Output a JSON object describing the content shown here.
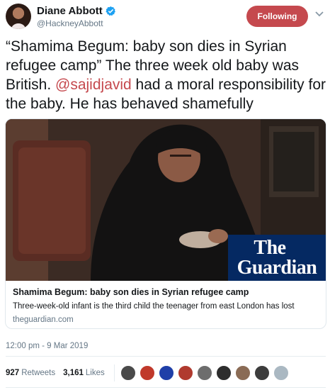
{
  "author": {
    "display_name": "Diane Abbott",
    "handle": "@HackneyAbbott",
    "verified_icon": "verified-badge-icon"
  },
  "follow_button": {
    "label": "Following"
  },
  "tweet": {
    "text_part1": "“Shamima Begum: baby son dies in Syrian refugee camp” The three week old baby was British. ",
    "mention": "@sajidjavid",
    "text_part2": " had a moral responsibility for the baby. He has behaved shamefully"
  },
  "card": {
    "logo_line1": "The",
    "logo_line2": "Guardian",
    "title": "Shamima Begum: baby son dies in Syrian refugee camp",
    "description": "Three-week-old infant is the third child the teenager from east London has lost",
    "domain": "theguardian.com"
  },
  "timestamp": "12:00 pm - 9 Mar 2019",
  "stats": {
    "retweets_count": "927",
    "retweets_label": "Retweets",
    "likes_count": "3,161",
    "likes_label": "Likes"
  },
  "colors": {
    "accent": "#c5494e",
    "guardian_blue": "#052962",
    "secondary_text": "#657786"
  },
  "liker_avatars": [
    {
      "name": "liker-avatar-1",
      "color": "#4a4a4a"
    },
    {
      "name": "liker-avatar-2",
      "color": "#c0392b"
    },
    {
      "name": "liker-avatar-3",
      "color": "#1f3fa8"
    },
    {
      "name": "liker-avatar-4",
      "color": "#b03a2e"
    },
    {
      "name": "liker-avatar-5",
      "color": "#6d6d6d"
    },
    {
      "name": "liker-avatar-6",
      "color": "#2d2d2d"
    },
    {
      "name": "liker-avatar-7",
      "color": "#8a6b55"
    },
    {
      "name": "liker-avatar-8",
      "color": "#3c3c3c"
    },
    {
      "name": "liker-avatar-9",
      "color": "#aab8c2"
    }
  ]
}
